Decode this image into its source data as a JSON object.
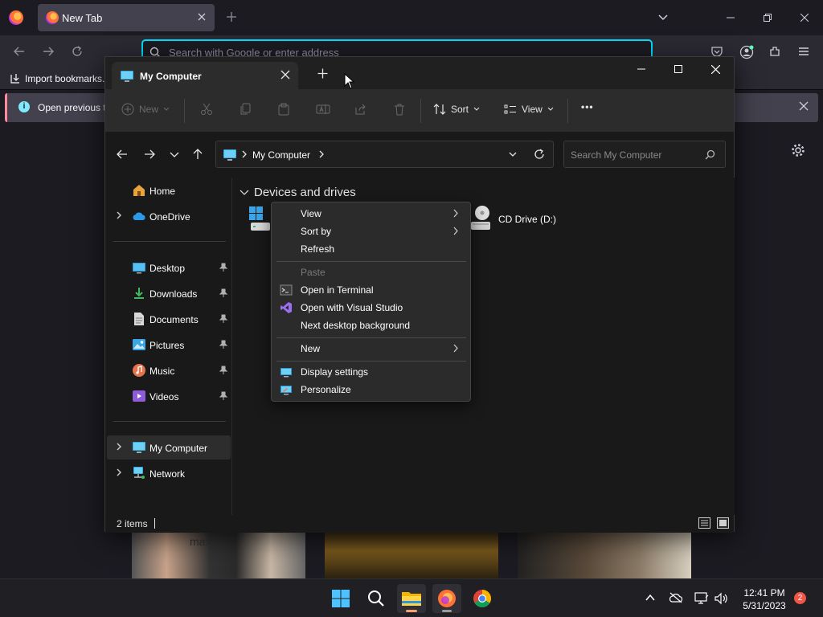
{
  "firefox": {
    "tab_title": "New Tab",
    "url_placeholder": "Search with Google or enter address",
    "bookmarks_import": "Import bookmarks...",
    "infobar_text": "Open previous t",
    "thumbnail_text": "max"
  },
  "explorer": {
    "tab_title": "My Computer",
    "toolbar": {
      "new_label": "New",
      "sort_label": "Sort",
      "view_label": "View",
      "more_label": "•••"
    },
    "address": {
      "path": "My Computer",
      "search_placeholder": "Search My Computer"
    },
    "nav": {
      "items": [
        {
          "label": "Home",
          "icon": "home-icon"
        },
        {
          "label": "OneDrive",
          "icon": "cloud-icon"
        },
        {
          "label": "Desktop",
          "icon": "desktop-icon"
        },
        {
          "label": "Downloads",
          "icon": "download-icon"
        },
        {
          "label": "Documents",
          "icon": "document-icon"
        },
        {
          "label": "Pictures",
          "icon": "pictures-icon"
        },
        {
          "label": "Music",
          "icon": "music-icon"
        },
        {
          "label": "Videos",
          "icon": "videos-icon"
        },
        {
          "label": "My Computer",
          "icon": "computer-icon"
        },
        {
          "label": "Network",
          "icon": "network-icon"
        }
      ]
    },
    "content": {
      "group_label": "Devices and drives",
      "drives": [
        {
          "label": "CD Drive (D:)",
          "icon": "cd-drive-icon"
        }
      ]
    },
    "status": {
      "item_count": "2 items"
    }
  },
  "context_menu": {
    "items": [
      {
        "label": "View",
        "submenu": true
      },
      {
        "label": "Sort by",
        "submenu": true
      },
      {
        "label": "Refresh"
      },
      {
        "label": "Paste",
        "disabled": true
      },
      {
        "label": "Open in Terminal",
        "icon": "terminal-icon"
      },
      {
        "label": "Open with Visual Studio",
        "icon": "visual-studio-icon"
      },
      {
        "label": "Next desktop background"
      },
      {
        "label": "New",
        "submenu": true
      },
      {
        "label": "Display settings",
        "icon": "display-icon"
      },
      {
        "label": "Personalize",
        "icon": "personalize-icon"
      }
    ]
  },
  "taskbar": {
    "time": "12:41 PM",
    "date": "5/31/2023",
    "notification_count": "2",
    "apps": [
      "start-icon",
      "search-icon",
      "file-explorer-icon",
      "firefox-icon",
      "chrome-icon"
    ]
  },
  "colors": {
    "accent": "#0078d4",
    "firefox_focus": "#00ddff",
    "badge": "#f05545"
  }
}
